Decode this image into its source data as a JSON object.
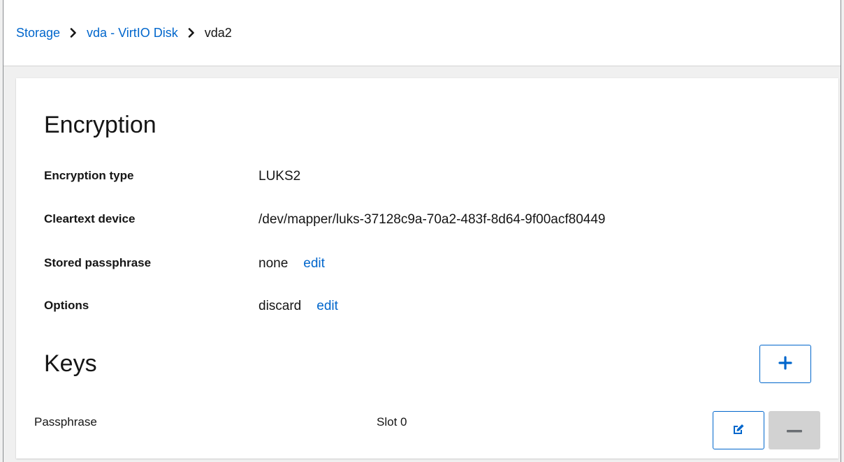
{
  "breadcrumb": {
    "items": [
      {
        "label": "Storage"
      },
      {
        "label": "vda - VirtIO Disk"
      },
      {
        "label": "vda2"
      }
    ]
  },
  "encryption": {
    "title": "Encryption",
    "fields": [
      {
        "label": "Encryption type",
        "value": "LUKS2"
      },
      {
        "label": "Cleartext device",
        "value": "/dev/mapper/luks-37128c9a-70a2-483f-8d64-9f00acf80449"
      },
      {
        "label": "Stored passphrase",
        "value": "none",
        "action": "edit"
      },
      {
        "label": "Options",
        "value": "discard",
        "action": "edit"
      }
    ]
  },
  "keys": {
    "title": "Keys",
    "add_icon": "plus-icon",
    "rows": [
      {
        "type": "Passphrase",
        "slot": "Slot 0",
        "edit_icon": "edit-icon",
        "remove_icon": "minus-icon"
      }
    ]
  },
  "colors": {
    "link": "#0066cc",
    "disabled_button": "#d2d2d2",
    "text": "#151515"
  }
}
